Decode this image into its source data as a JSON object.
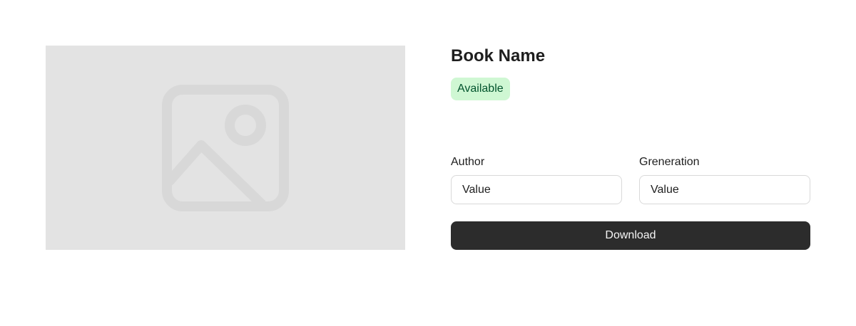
{
  "product": {
    "image_icon": "image-placeholder-icon",
    "title": "Book Name",
    "status_badge": "Available",
    "fields": {
      "author": {
        "label": "Author",
        "value": "Value"
      },
      "generation": {
        "label": "Greneration",
        "value": "Value"
      }
    },
    "download_label": "Download"
  },
  "colors": {
    "image_background": "#e3e3e3",
    "badge_background": "#cff7d3",
    "badge_text": "#02542d",
    "button_background": "#2c2c2c",
    "button_text": "#f5f5f5"
  }
}
